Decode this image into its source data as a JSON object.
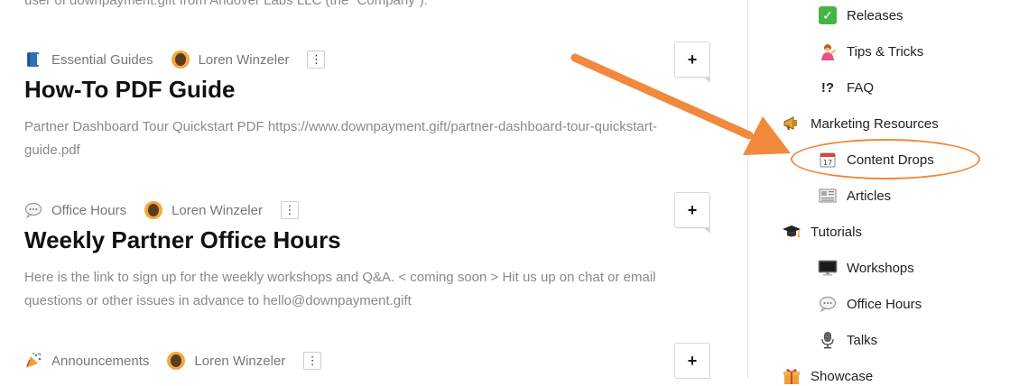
{
  "intro_text": "user of downpayment.gift from Andover Labs LLC (the “Company”).",
  "posts": [
    {
      "category": "Essential Guides",
      "category_icon": "blue-book-icon",
      "author": "Loren Winzeler",
      "title": "How-To PDF Guide",
      "description": "Partner Dashboard Tour Quickstart PDF https://www.downpayment.gift/partner-dashboard-tour-quickstart-guide.pdf",
      "add_label": "+",
      "menu_label": "⋮"
    },
    {
      "category": "Office Hours",
      "category_icon": "speech-bubble-icon",
      "author": "Loren Winzeler",
      "title": "Weekly Partner Office Hours",
      "description": "Here is the link to sign up for the weekly workshops and Q&A. < coming soon > Hit us up on chat or email questions or other issues in advance to hello@downpayment.gift",
      "add_label": "+",
      "menu_label": "⋮"
    },
    {
      "category": "Announcements",
      "category_icon": "party-popper-icon",
      "author": "Loren Winzeler",
      "add_label": "+",
      "menu_label": "⋮"
    }
  ],
  "sidebar": {
    "items": [
      {
        "label": "Releases",
        "icon": "check-mark-icon"
      },
      {
        "label": "Tips & Tricks",
        "icon": "person-tipping-hand-icon"
      },
      {
        "label": "FAQ",
        "icon": "interrobang-icon",
        "glyph": "!?"
      },
      {
        "label": "Marketing Resources",
        "icon": "megaphone-icon"
      },
      {
        "label": "Content Drops",
        "icon": "calendar-icon",
        "highlighted": true
      },
      {
        "label": "Articles",
        "icon": "newspaper-icon"
      },
      {
        "label": "Tutorials",
        "icon": "graduation-cap-icon"
      },
      {
        "label": "Workshops",
        "icon": "desktop-computer-icon"
      },
      {
        "label": "Office Hours",
        "icon": "speech-bubble-icon"
      },
      {
        "label": "Talks",
        "icon": "microphone-icon"
      },
      {
        "label": "Showcase",
        "icon": "gift-icon"
      }
    ]
  },
  "colors": {
    "annotation": "#f0893b",
    "check": "#44b544",
    "title": "#111111",
    "muted": "#8a8a8a"
  }
}
